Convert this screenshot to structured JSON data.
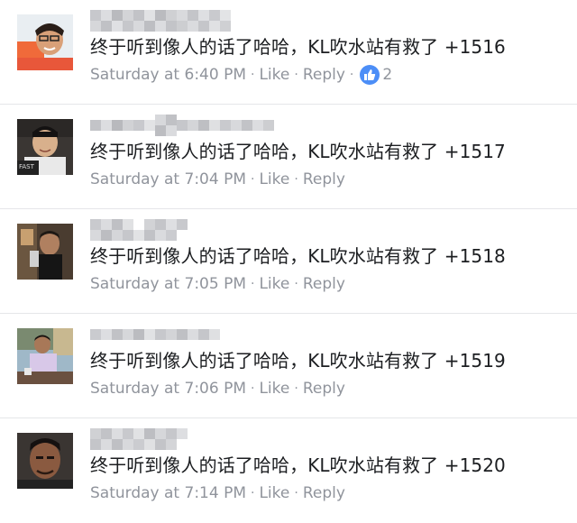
{
  "comments": [
    {
      "text": "终于听到像人的话了哈哈，KL吹水站有救了 +1516",
      "time": "Saturday at 6:40 PM",
      "like_label": "Like",
      "reply_label": "Reply",
      "reaction_count": "2",
      "reaction_icon": "thumbs-up-icon"
    },
    {
      "text": "终于听到像人的话了哈哈，KL吹水站有救了 +1517",
      "time": "Saturday at 7:04 PM",
      "like_label": "Like",
      "reply_label": "Reply"
    },
    {
      "text": "终于听到像人的话了哈哈，KL吹水站有救了 +1518",
      "time": "Saturday at 7:05 PM",
      "like_label": "Like",
      "reply_label": "Reply"
    },
    {
      "text": "终于听到像人的话了哈哈，KL吹水站有救了 +1519",
      "time": "Saturday at 7:06 PM",
      "like_label": "Like",
      "reply_label": "Reply"
    },
    {
      "text": "终于听到像人的话了哈哈，KL吹水站有救了 +1520",
      "time": "Saturday at 7:14 PM",
      "like_label": "Like",
      "reply_label": "Reply"
    }
  ],
  "separator": "·",
  "colors": {
    "text": "#1c1e21",
    "meta": "#90949c",
    "like_badge": "#4c8ef7",
    "divider": "#e5e6e9"
  }
}
